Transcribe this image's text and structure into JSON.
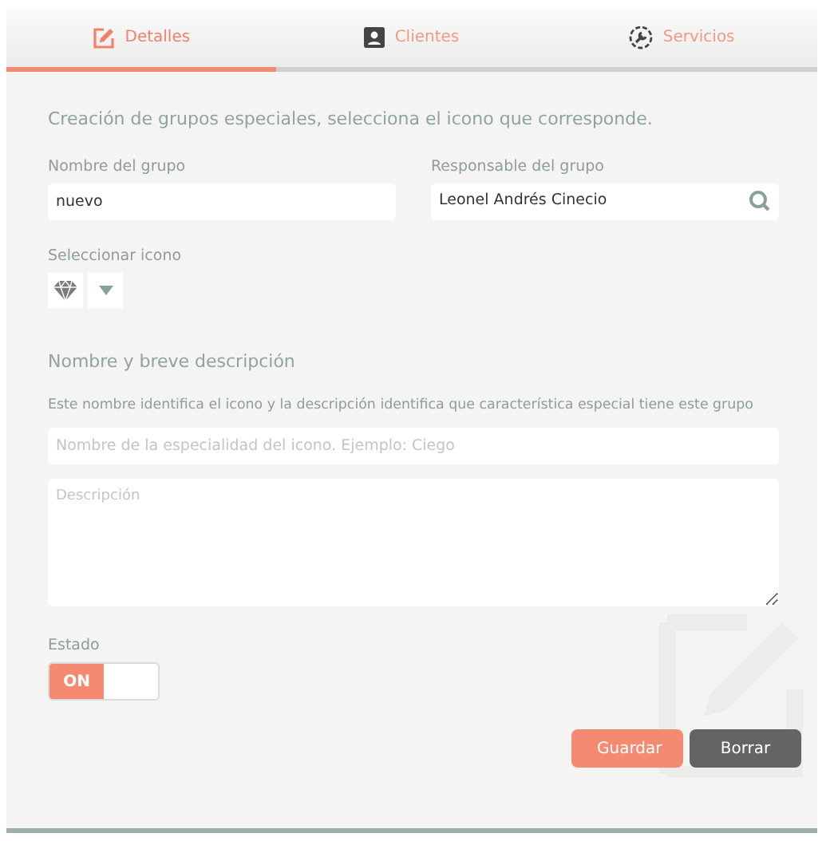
{
  "tabs": [
    {
      "label": "Detalles",
      "kind": "edit",
      "selected": true
    },
    {
      "label": "Clientes",
      "kind": "contact",
      "selected": false
    },
    {
      "label": "Servicios",
      "kind": "wrench",
      "selected": false
    }
  ],
  "intro": "Creación de grupos especiales, selecciona el icono que corresponde.",
  "group_name": {
    "label": "Nombre del grupo",
    "value": "nuevo"
  },
  "owner": {
    "label": "Responsable del grupo",
    "value": "Leonel Andrés Cinecio"
  },
  "icon_select": {
    "label": "Seleccionar icono"
  },
  "section_title": "Nombre y breve descripción",
  "section_help": "Este nombre identifica el icono y la descripción identifica que característica especial tiene este grupo",
  "specialty_name": {
    "placeholder": "Nombre de la especialidad del icono. Ejemplo: Ciego"
  },
  "description": {
    "placeholder": "Descripción"
  },
  "status": {
    "label": "Estado",
    "on": true,
    "on_text": "ON"
  },
  "buttons": [
    {
      "label": "Guardar",
      "kind": "primary"
    },
    {
      "label": "Borrar",
      "kind": "secondary"
    }
  ]
}
